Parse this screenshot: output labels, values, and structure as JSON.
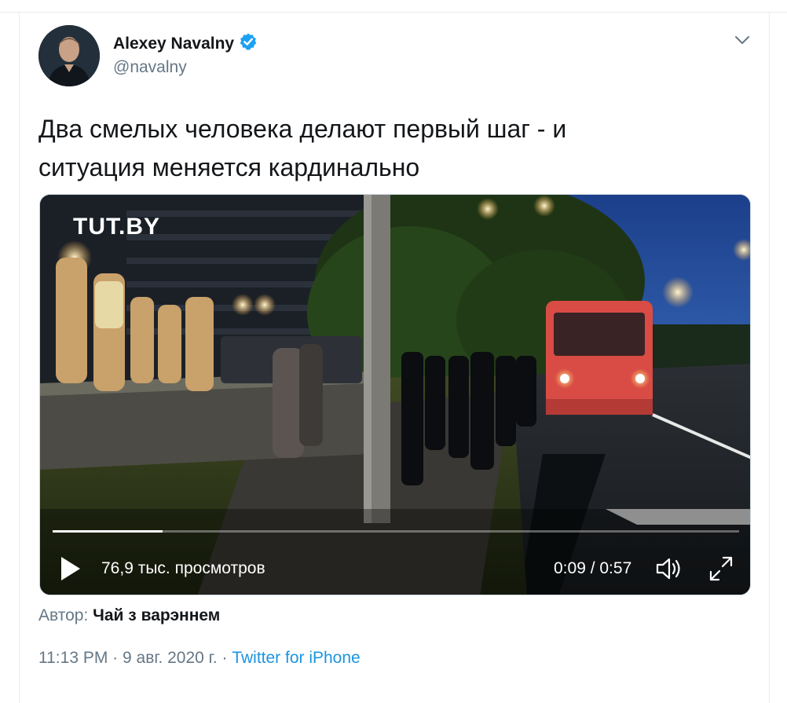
{
  "tweet": {
    "author_name": "Alexey Navalny",
    "author_handle": "@navalny",
    "verified": true,
    "text_line1": "Два смелых человека делают первый шаг - и",
    "text_line2": "ситуация меняется кардинально"
  },
  "video": {
    "brand": "TUT.BY",
    "views": "76,9 тыс. просмотров",
    "time": "0:09 / 0:57",
    "progress": 0.16,
    "icons": {
      "play": "play-icon",
      "volume": "volume-icon",
      "fullscreen": "fullscreen-icon"
    }
  },
  "attribution": {
    "label": "Автор:",
    "name": "Чай з варэннем"
  },
  "meta": {
    "time": "11:13 PM",
    "separator": "·",
    "date": "9 авг. 2020 г.",
    "source": "Twitter for iPhone"
  },
  "colors": {
    "verified": "#1da1f2",
    "link": "#1b95e0",
    "secondary_text": "#657786"
  }
}
